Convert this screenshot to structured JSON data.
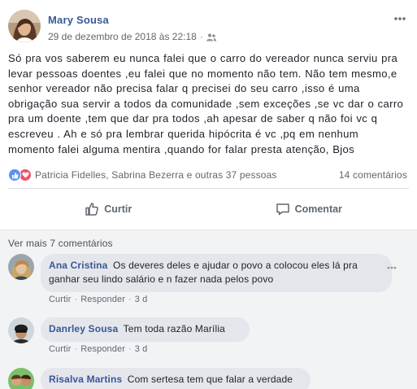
{
  "post": {
    "author": "Mary Sousa",
    "timestamp": "29 de dezembro de 2018 às 22:18",
    "separator": "·",
    "privacy_icon": "friends-icon",
    "more_icon": "more-options-icon",
    "lines": [
      "Só pra vos saberem eu nunca falei que o carro do vereador nunca serviu pra",
      "levar pessoas doentes ,eu falei que no momento não tem. Não tem mesmo,e",
      "senhor vereador não precisa falar q precisei do seu carro ,isso é uma",
      "obrigação sua servir a todos da comunidade ,sem exceções ,se vc dar o carro",
      "pra um doente ,tem que dar pra todos ,ah apesar de saber q não foi vc q",
      "escreveu . Ah e só pra lembrar querida hipócrita é vc ,pq em nenhum",
      "momento falei alguma mentira ,quando for falar presta atenção, Bjos"
    ]
  },
  "reactions": {
    "icons": [
      "like-icon",
      "love-icon"
    ],
    "names": "Patricia Fidelles, Sabrina Bezerra e outras 37 pessoas",
    "comment_count": "14 comentários"
  },
  "actions": {
    "like_label": "Curtir",
    "comment_label": "Comentar"
  },
  "comments": {
    "more_label": "Ver mais 7 comentários",
    "items": [
      {
        "name": "Ana Cristina",
        "text": "Os deveres deles e ajudar o povo a colocou eles lá pra\nganhar seu lindo salário e n fazer nada pelos povo",
        "like": "Curtir",
        "reply": "Responder",
        "time": "3 d"
      },
      {
        "name": "Danrley Sousa",
        "text": "Tem toda razão Marília",
        "like": "Curtir",
        "reply": "Responder",
        "time": "3 d"
      },
      {
        "name": "Risalva Martins",
        "text": "Com sertesa tem que falar a verdade"
      }
    ]
  },
  "colors": {
    "author_blue": "#365899",
    "like_blue": "#5890ff",
    "love_red": "#f25268",
    "comments_bg": "#f2f3f5",
    "bubble_bg": "#e4e6eb"
  }
}
